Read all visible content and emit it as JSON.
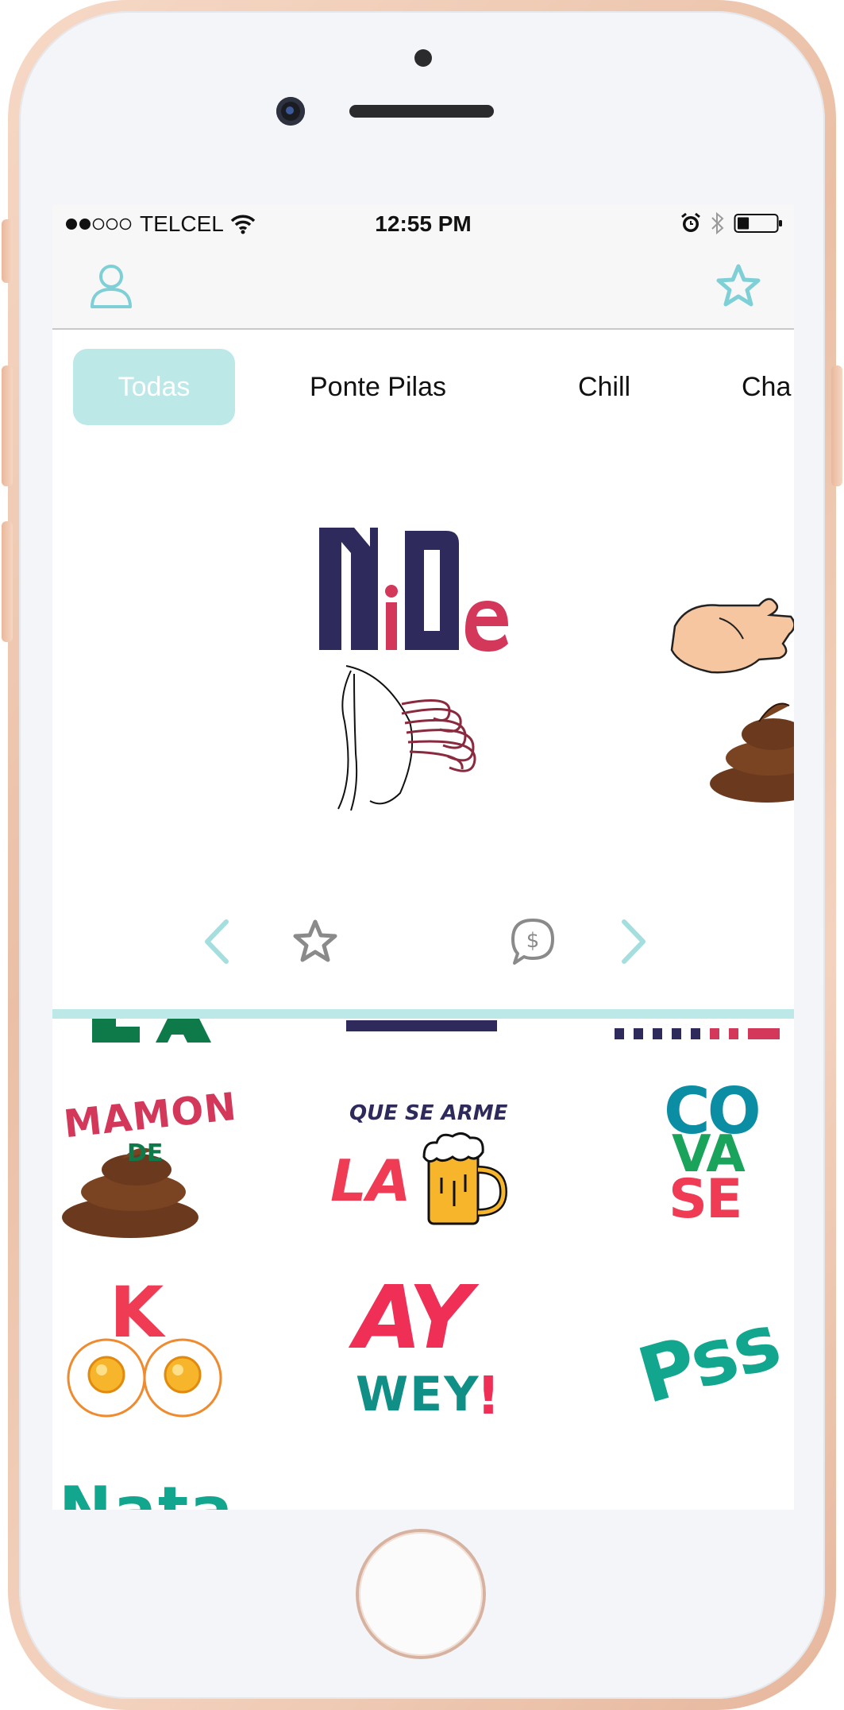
{
  "status_bar": {
    "carrier": "TELCEL",
    "time": "12:55 PM",
    "signal_icon": "signal-dots-icon",
    "wifi_icon": "wifi-icon",
    "alarm_icon": "alarm-icon",
    "bluetooth_icon": "bluetooth-icon",
    "battery_icon": "battery-icon",
    "battery_level": 0.3
  },
  "nav": {
    "profile_icon": "user-icon",
    "favorites_icon": "star-icon",
    "accent_color": "#7fd0d6"
  },
  "tabs": [
    {
      "label": "Todas",
      "active": true
    },
    {
      "label": "Ponte Pilas",
      "active": false
    },
    {
      "label": "Chill",
      "active": false
    },
    {
      "label": "Cha",
      "active": false
    }
  ],
  "featured": {
    "sticker_text_line1": "Ni De",
    "next_sticker": "poop-hand-sticker"
  },
  "controls": {
    "prev_icon": "chevron-left-icon",
    "favorite_icon": "star-icon",
    "buy_icon": "dollar-speech-icon",
    "next_icon": "chevron-right-icon"
  },
  "stickers": {
    "mamon": {
      "line1": "MAMON",
      "line2": "DE"
    },
    "arme": {
      "line1": "QUE SE ARME",
      "line2": "LA"
    },
    "covase": {
      "line1": "CO",
      "line2": "VA",
      "line3": "SE"
    },
    "k": {
      "text": "K"
    },
    "aywey": {
      "line1": "AY",
      "line2": "WEY",
      "line3": "!"
    },
    "pss": {
      "text": "Pss"
    },
    "partial_bottom": {
      "text": "Nata"
    }
  }
}
